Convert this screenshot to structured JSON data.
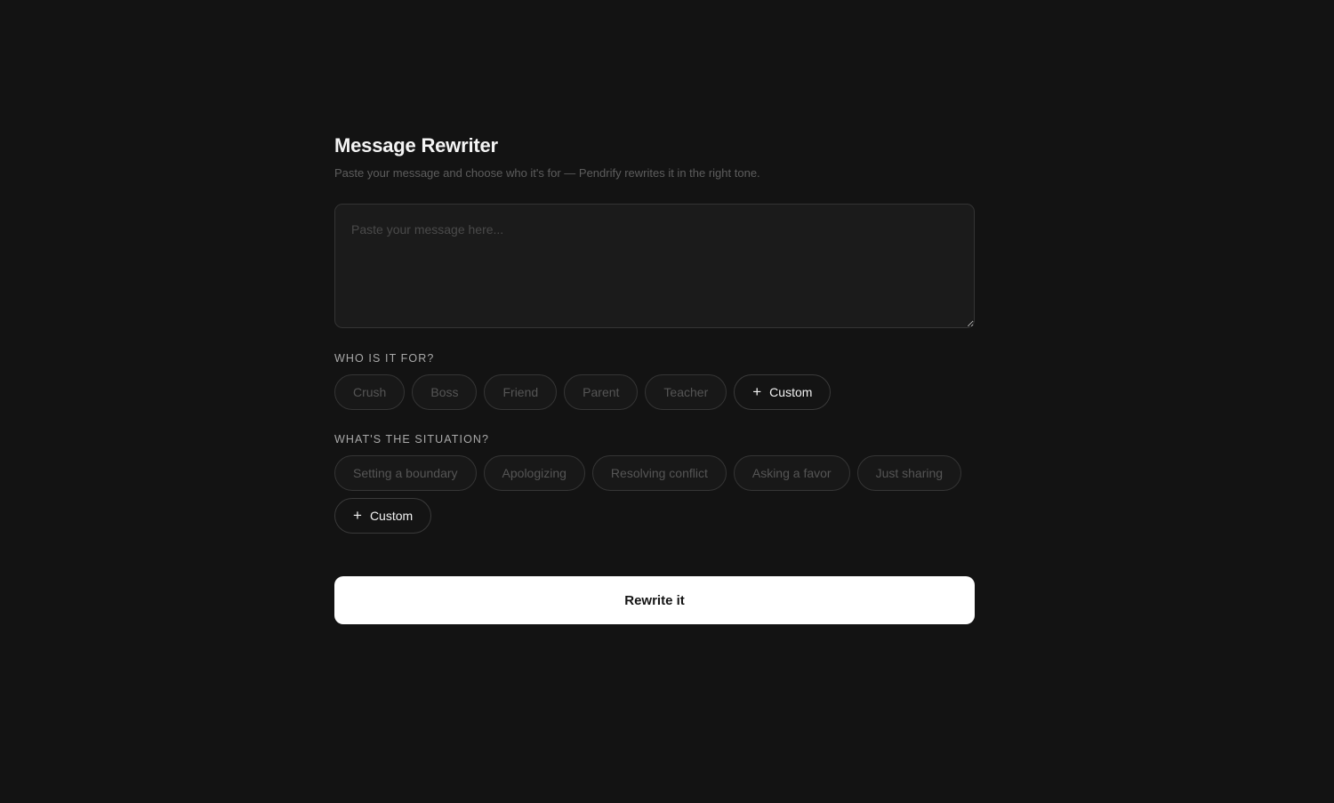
{
  "header": {
    "title": "Message Rewriter",
    "subtitle": "Paste your message and choose who it's for — Pendrify rewrites it in the right tone."
  },
  "message": {
    "value": "",
    "placeholder": "Paste your message here..."
  },
  "recipient": {
    "label": "WHO IS IT FOR?",
    "options": [
      "Crush",
      "Boss",
      "Friend",
      "Parent",
      "Teacher"
    ],
    "custom_label": "Custom"
  },
  "situation": {
    "label": "WHAT'S THE SITUATION?",
    "options": [
      "Setting a boundary",
      "Apologizing",
      "Resolving conflict",
      "Asking a favor",
      "Just sharing"
    ],
    "custom_label": "Custom"
  },
  "action": {
    "submit_label": "Rewrite it"
  },
  "icons": {
    "add": "plus-icon"
  },
  "colors": {
    "background": "#131313",
    "primary_button": "#ffffff",
    "chip_border": "#353535"
  }
}
